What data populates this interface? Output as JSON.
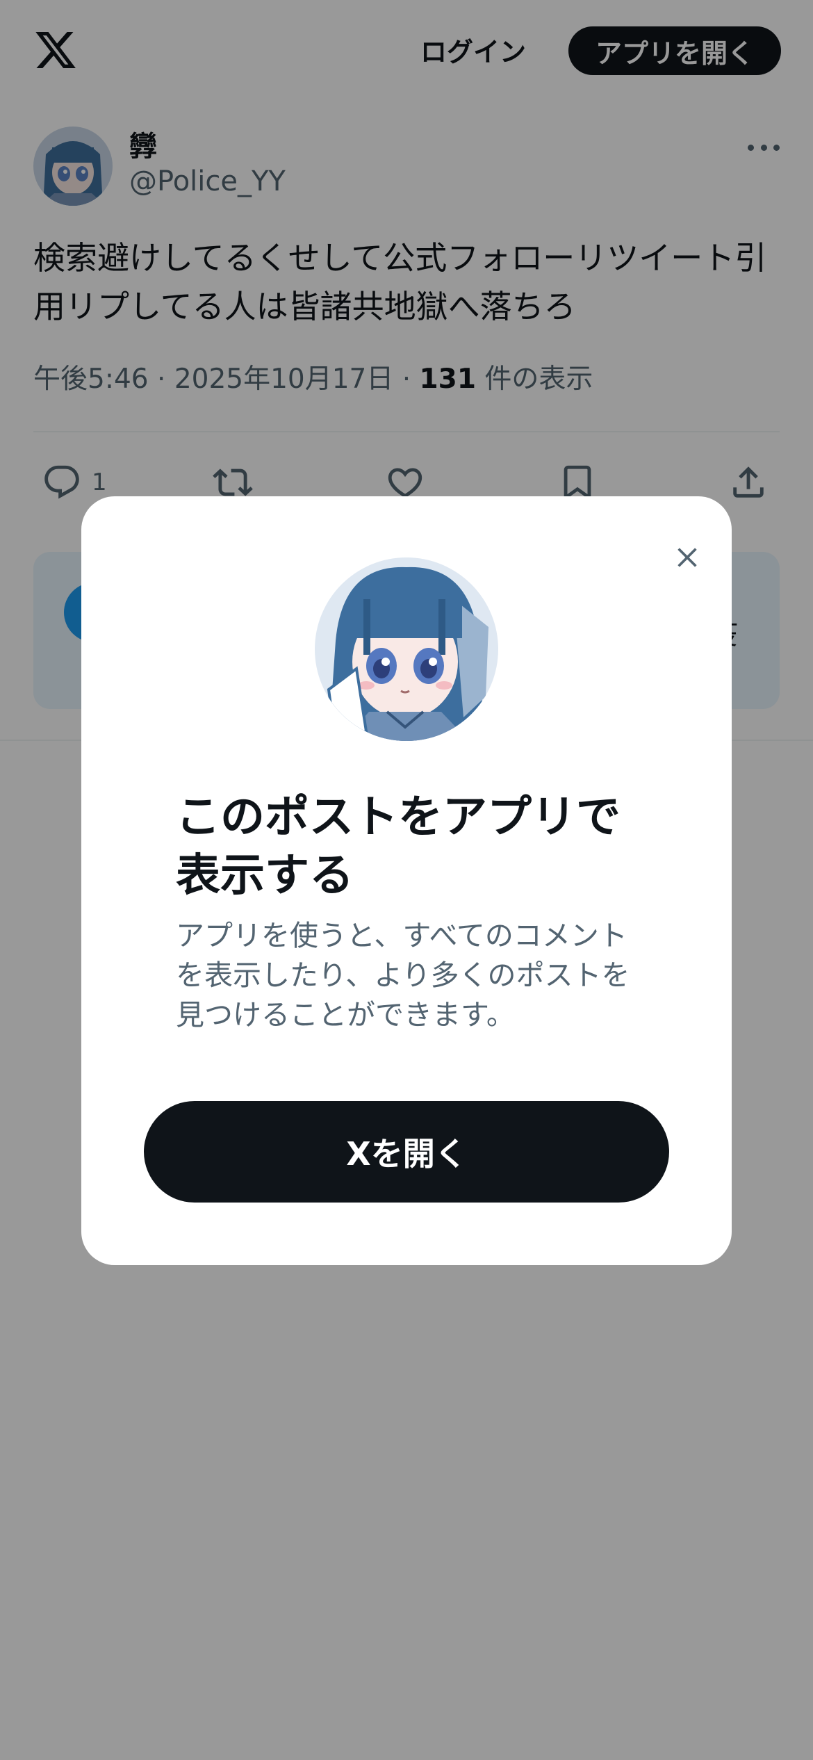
{
  "header": {
    "logo_icon": "x-logo-icon",
    "login_label": "ログイン",
    "open_app_label": "アプリを開く"
  },
  "tweet": {
    "display_name": "㝈",
    "handle": "@Police_YY",
    "text": "検索避けしてるくせして公式フォローリツイート引用リプしてる人は皆諸共地獄へ落ちろ",
    "time": "午後5:46",
    "date": "2025年10月17日",
    "views_count": "131",
    "views_label": "件の表示",
    "separator": "·",
    "reply_count": "1",
    "more_icon": "more-horizontal-icon"
  },
  "actions": {
    "reply_icon": "reply-icon",
    "retweet_icon": "retweet-icon",
    "like_icon": "heart-icon",
    "bookmark_icon": "bookmark-icon",
    "share_icon": "share-icon"
  },
  "card": {
    "trailing_glyph": "疫"
  },
  "modal": {
    "close_icon": "close-icon",
    "title": "このポストをアプリで表示する",
    "description": "アプリを使うと、すべてのコメントを表示したり、より多くのポストを見つけることができます。",
    "cta_label": "Xを開く"
  },
  "colors": {
    "text_primary": "#0f1419",
    "text_secondary": "#536471",
    "button_dark": "#0f1419",
    "scrim": "rgba(0,0,0,0.4)",
    "card_bg": "#e8f5fd",
    "accent_blue": "#1d9bf0"
  }
}
